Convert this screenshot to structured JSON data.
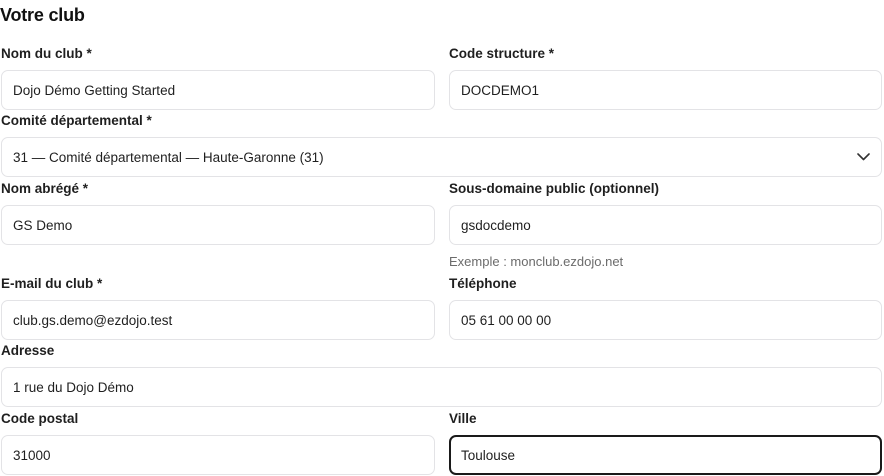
{
  "section": {
    "title": "Votre club"
  },
  "fields": {
    "club_name": {
      "label": "Nom du club *",
      "value": "Dojo Démo Getting Started"
    },
    "structure_code": {
      "label": "Code structure *",
      "value": "DOCDEMO1"
    },
    "committee": {
      "label": "Comité départemental *",
      "value": "31 — Comité départemental — Haute-Garonne (31)"
    },
    "short_name": {
      "label": "Nom abrégé *",
      "value": "GS Demo"
    },
    "subdomain": {
      "label": "Sous-domaine public (optionnel)",
      "value": "gsdocdemo",
      "hint": "Exemple : monclub.ezdojo.net"
    },
    "email": {
      "label": "E-mail du club *",
      "value": "club.gs.demo@ezdojo.test"
    },
    "phone": {
      "label": "Téléphone",
      "value": "05 61 00 00 00"
    },
    "address": {
      "label": "Adresse",
      "value": "1 rue du Dojo Démo"
    },
    "postal_code": {
      "label": "Code postal",
      "value": "31000"
    },
    "city": {
      "label": "Ville",
      "value": "Toulouse"
    }
  },
  "icons": {
    "committee_dropdown": "chevron-down-icon"
  }
}
